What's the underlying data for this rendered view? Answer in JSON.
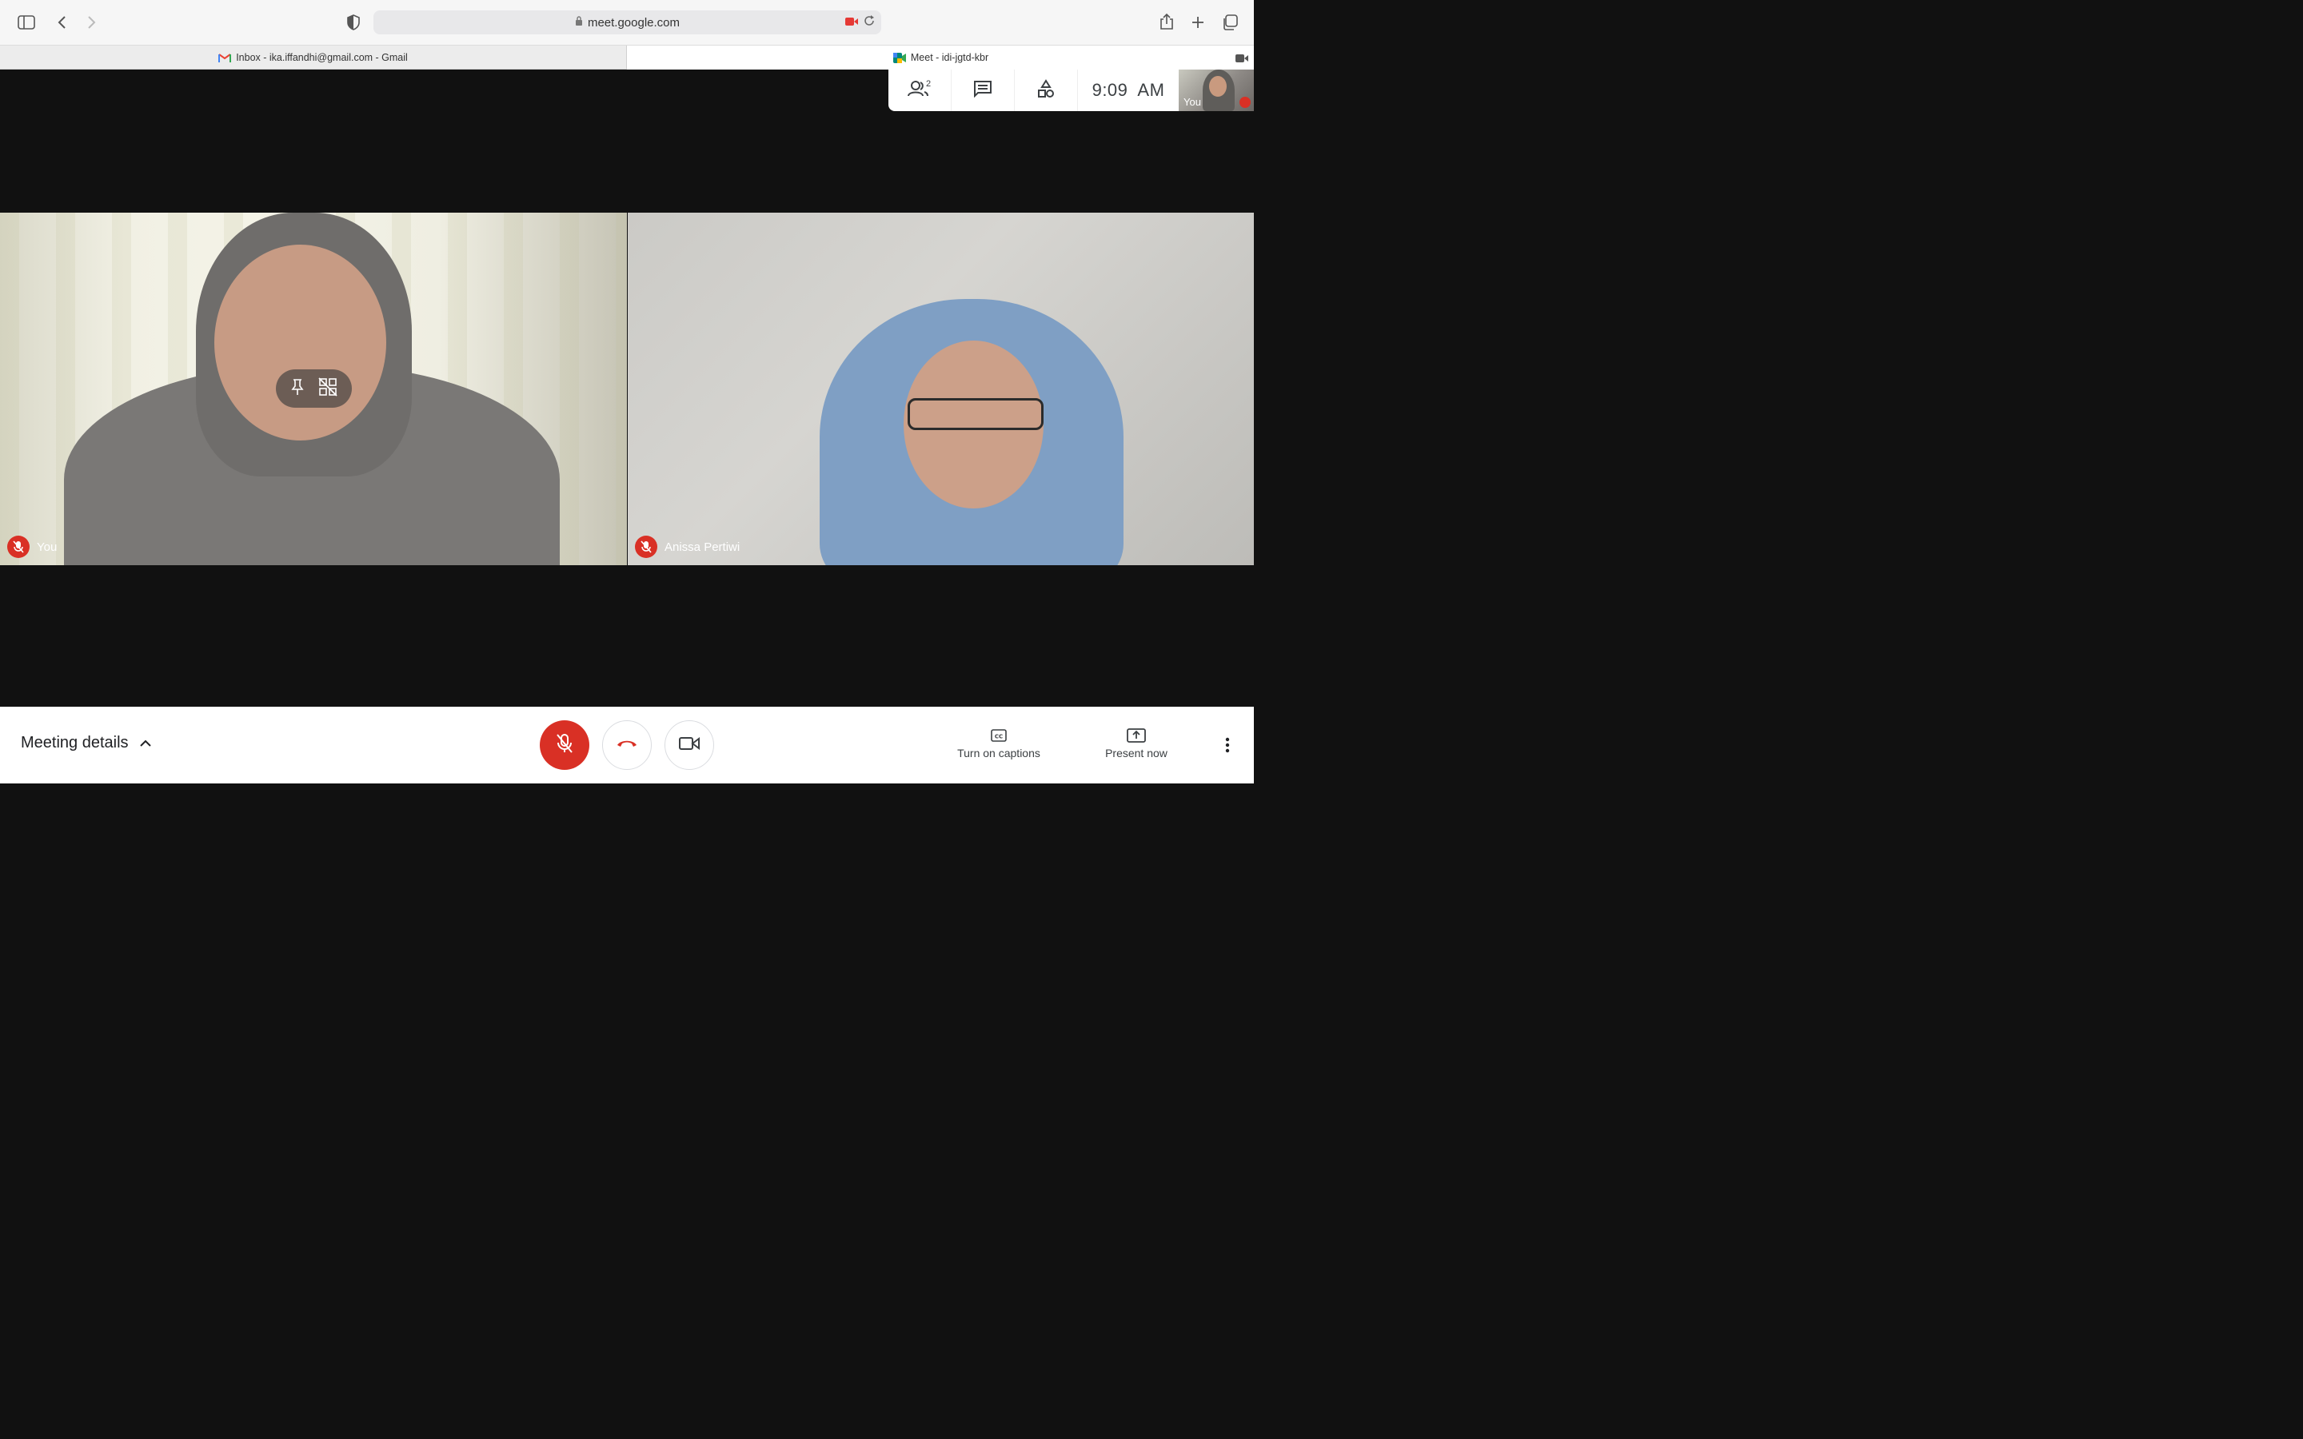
{
  "browser": {
    "url": "meet.google.com",
    "tabs": [
      {
        "label": "Inbox - ika.iffandhi@gmail.com - Gmail",
        "active": false
      },
      {
        "label": "Meet - idi-jgtd-kbr",
        "active": true
      }
    ]
  },
  "meet": {
    "participant_count": "2",
    "time": "9:09  AM",
    "self_thumb_label": "You",
    "tiles": [
      {
        "name": "You",
        "muted": true
      },
      {
        "name": "Anissa Pertiwi",
        "muted": true
      }
    ],
    "bottom": {
      "meeting_details": "Meeting details",
      "captions_label": "Turn on captions",
      "present_label": "Present now"
    }
  },
  "colors": {
    "danger": "#d93025",
    "meet_bg": "#111111"
  },
  "icons": {
    "sidebar": "sidebar-icon",
    "back": "back-icon",
    "forward": "forward-icon",
    "shield": "shield-icon",
    "share": "share-icon",
    "new_tab": "plus-icon",
    "tabs_overview": "tabs-icon"
  }
}
